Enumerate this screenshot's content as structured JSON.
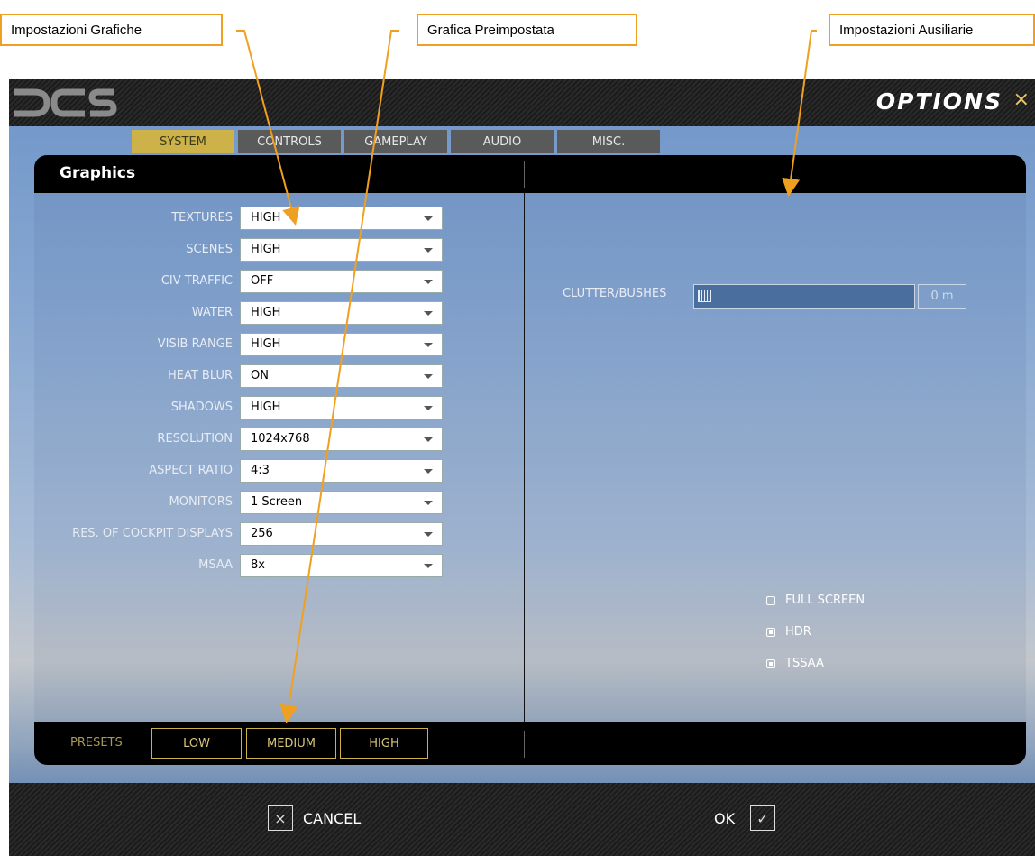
{
  "callouts": {
    "graphic_settings": "Impostazioni Grafiche",
    "preset_graphics": "Grafica Preimpostata",
    "auxiliary_settings": "Impostazioni Ausiliarie"
  },
  "window": {
    "title": "OPTIONS",
    "close_glyph": "×",
    "logo_text": "DCS"
  },
  "tabs": [
    "SYSTEM",
    "CONTROLS",
    "GAMEPLAY",
    "AUDIO",
    "MISC."
  ],
  "active_tab": "SYSTEM",
  "panel": {
    "title": "Graphics"
  },
  "settings": [
    {
      "label": "TEXTURES",
      "value": "HIGH"
    },
    {
      "label": "SCENES",
      "value": "HIGH"
    },
    {
      "label": "CIV TRAFFIC",
      "value": "OFF"
    },
    {
      "label": "WATER",
      "value": "HIGH"
    },
    {
      "label": "VISIB RANGE",
      "value": "HIGH"
    },
    {
      "label": "HEAT BLUR",
      "value": "ON"
    },
    {
      "label": "SHADOWS",
      "value": "HIGH"
    },
    {
      "label": "RESOLUTION",
      "value": "1024x768"
    },
    {
      "label": "ASPECT RATIO",
      "value": "4:3"
    },
    {
      "label": "MONITORS",
      "value": "1 Screen"
    },
    {
      "label": "RES. OF COCKPIT DISPLAYS",
      "value": "256"
    },
    {
      "label": "MSAA",
      "value": "8x"
    }
  ],
  "clutter": {
    "label": "CLUTTER/BUSHES",
    "value": "0 m",
    "level": 0
  },
  "checkboxes": [
    {
      "label": "FULL SCREEN",
      "checked": false
    },
    {
      "label": "HDR",
      "checked": true
    },
    {
      "label": "TSSAA",
      "checked": true
    }
  ],
  "presets": {
    "label": "PRESETS",
    "buttons": [
      "LOW",
      "MEDIUM",
      "HIGH"
    ]
  },
  "footer": {
    "cancel_label": "CANCEL",
    "cancel_glyph": "×",
    "ok_label": "OK",
    "ok_glyph": "✓"
  },
  "colors": {
    "callout_border": "#f0a020",
    "active_tab": "#cdb24a",
    "preset_accent": "#cdb24a"
  }
}
